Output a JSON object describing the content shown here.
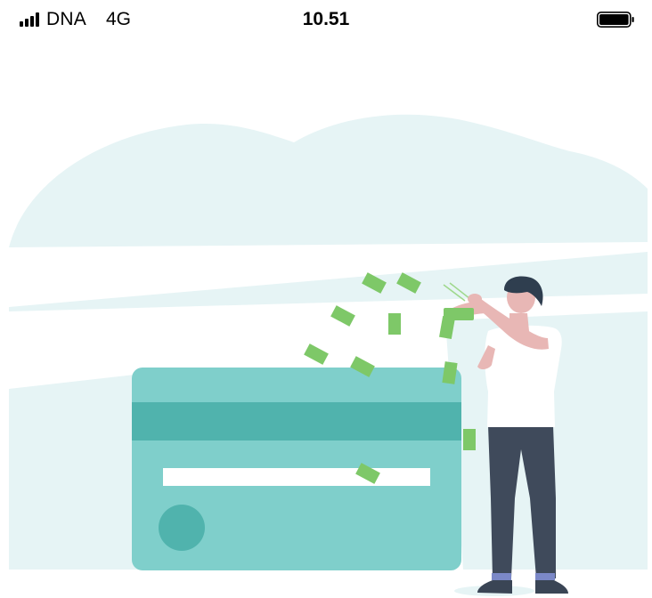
{
  "status_bar": {
    "carrier": "DNA",
    "network": "4G",
    "time": "10.51",
    "signal_bars": 4,
    "battery_level": 1.0
  },
  "illustration": {
    "theme": "payment-card-with-falling-money",
    "colors": {
      "sky": "#e6f4f5",
      "card": "#7fcfcb",
      "card_stripe": "#50b3ad",
      "card_line": "#ffffff",
      "money": "#7ec868",
      "skin": "#e8b7b5",
      "hair": "#2f3e4f",
      "shirt": "#ffffff",
      "pants": "#3f4a5b",
      "shoes": "#3a4555"
    }
  }
}
